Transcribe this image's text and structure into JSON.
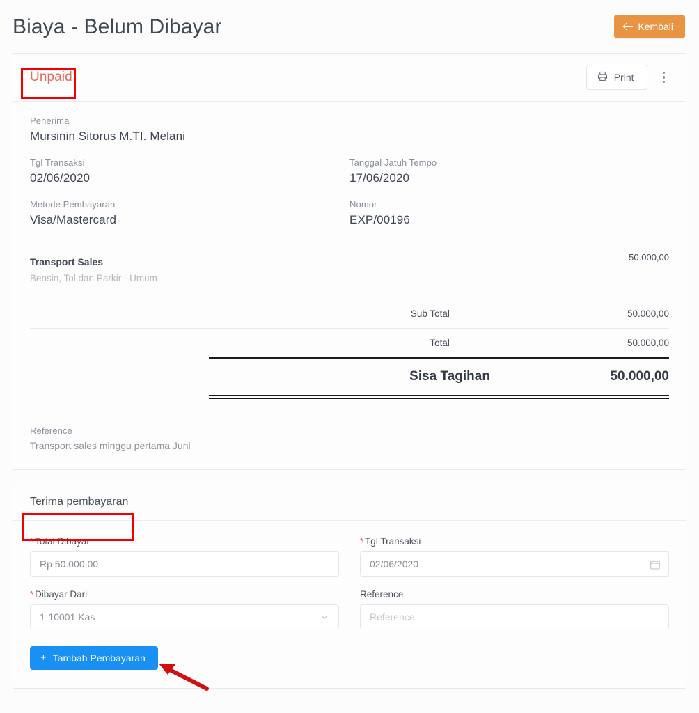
{
  "header": {
    "title": "Biaya - Belum Dibayar",
    "back_button": "Kembali",
    "back_icon": "arrow-left-icon"
  },
  "detail_card": {
    "status": "Unpaid",
    "print_button": "Print",
    "print_icon": "printer-icon",
    "more_icon": "kebab-menu-icon",
    "fields": {
      "penerima_label": "Penerima",
      "penerima_value": "Mursinin Sitorus M.TI. Melani",
      "tgl_transaksi_label": "Tgl Transaksi",
      "tgl_transaksi_value": "02/06/2020",
      "jatuh_tempo_label": "Tanggal Jatuh Tempo",
      "jatuh_tempo_value": "17/06/2020",
      "metode_label": "Metode Pembayaran",
      "metode_value": "Visa/Mastercard",
      "nomor_label": "Nomor",
      "nomor_value": "EXP/00196"
    },
    "line_items": [
      {
        "name": "Transport Sales",
        "description": "Bensin, Tol dan Parkir - Umum",
        "amount": "50.000,00"
      }
    ],
    "totals": [
      {
        "label": "Sub Total",
        "value": "50.000,00"
      },
      {
        "label": "Total",
        "value": "50.000,00"
      }
    ],
    "grand_total": {
      "label": "Sisa Tagihan",
      "value": "50.000,00"
    },
    "reference_label": "Reference",
    "reference_value": "Transport sales minggu pertama Juni"
  },
  "payment_card": {
    "title": "Terima pembayaran",
    "total_dibayar": {
      "label": "Total Dibayar",
      "required": true,
      "value": "Rp 50.000,00"
    },
    "tgl_transaksi": {
      "label": "Tgl Transaksi",
      "required": true,
      "value": "02/06/2020",
      "icon": "calendar-icon"
    },
    "dibayar_dari": {
      "label": "Dibayar Dari",
      "required": true,
      "value": "1-10001 Kas",
      "icon": "chevron-down-icon"
    },
    "reference": {
      "label": "Reference",
      "required": false,
      "value": "",
      "placeholder": "Reference"
    },
    "submit_button": "Tambah Pembayaran",
    "submit_icon": "plus-icon"
  },
  "colors": {
    "back_button": "#e89442",
    "status": "#e8685c",
    "submit_button": "#1890f4",
    "annotation": "#f40000",
    "required": "#e8564a"
  }
}
